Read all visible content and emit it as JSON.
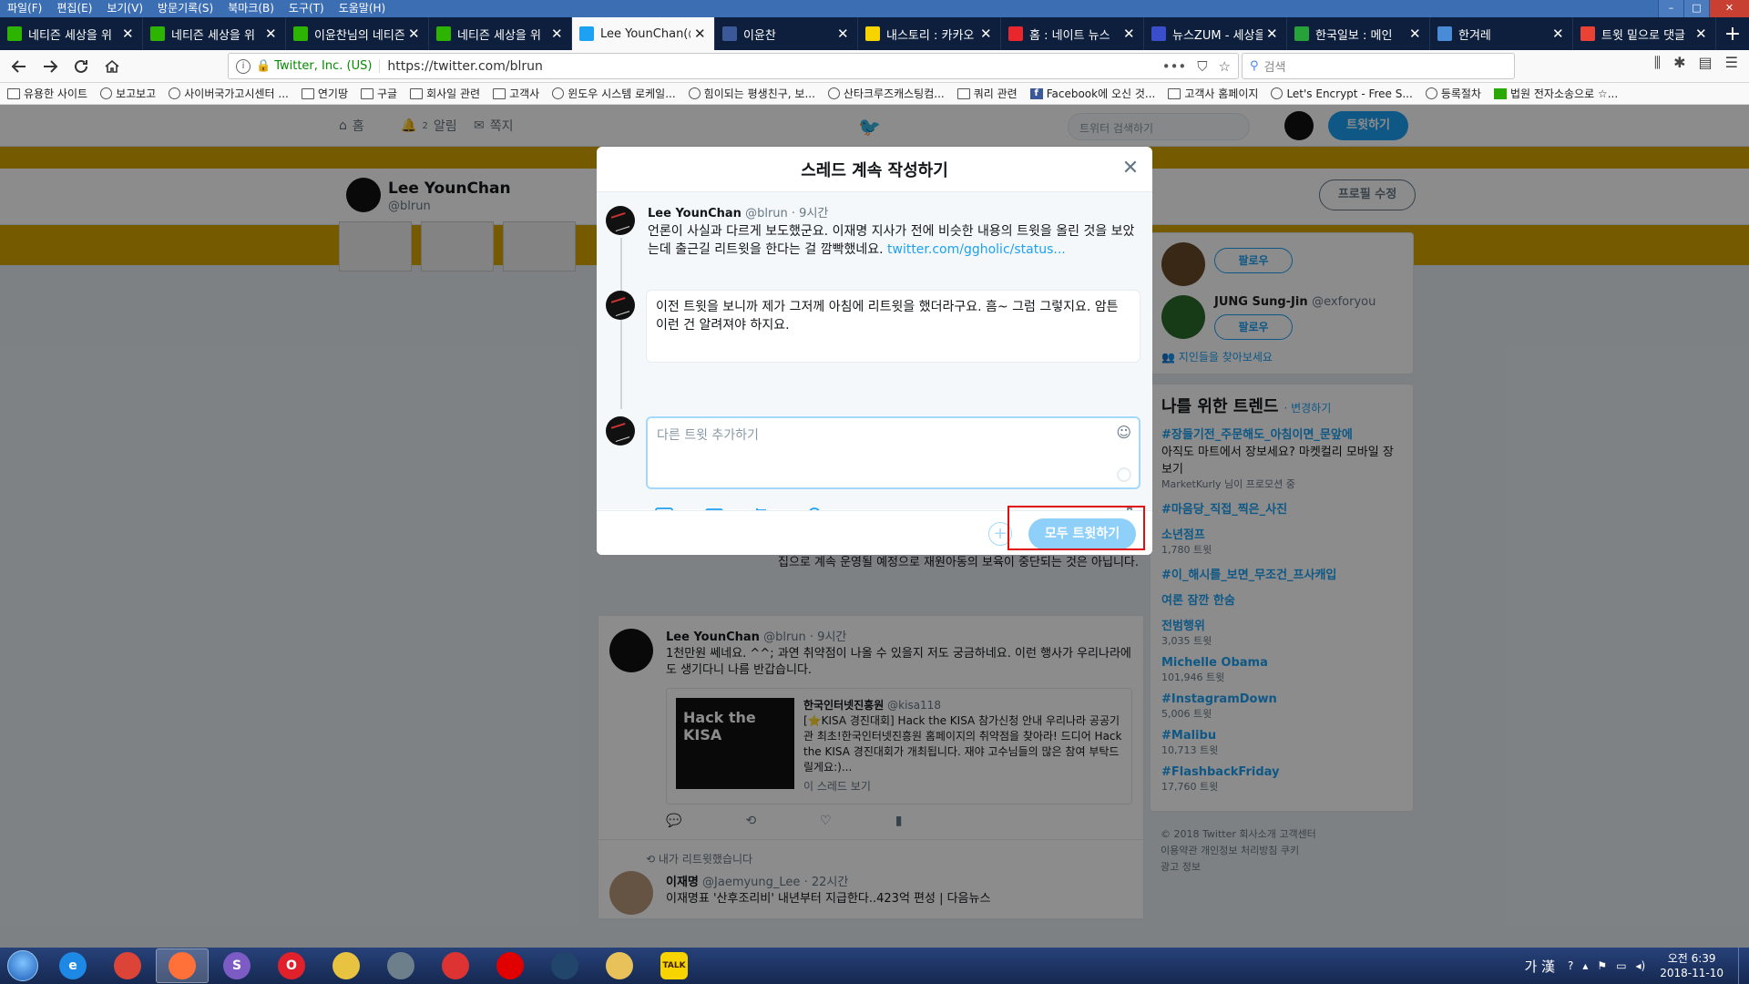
{
  "browser": {
    "menu": [
      "파일(F)",
      "편집(E)",
      "보기(V)",
      "방문기록(S)",
      "북마크(B)",
      "도구(T)",
      "도움말(H)"
    ],
    "tabs": [
      {
        "title": "네티즌 세상을 위",
        "icon": "naver-icon",
        "color": "#2db400"
      },
      {
        "title": "네티즌 세상을 위",
        "icon": "naver-icon",
        "color": "#2db400"
      },
      {
        "title": "이윤찬님의 네티즌",
        "icon": "naver-icon",
        "color": "#2db400"
      },
      {
        "title": "네티즌 세상을 위",
        "icon": "naver-icon",
        "color": "#2db400"
      },
      {
        "title": "Lee YounChan(@",
        "icon": "twitter-icon",
        "color": "#1da1f2",
        "active": true
      },
      {
        "title": "이윤찬",
        "icon": "facebook-icon",
        "color": "#3b5998"
      },
      {
        "title": "내스토리 : 카카오",
        "icon": "kakao-icon",
        "color": "#f7d300"
      },
      {
        "title": "홈 : 네이트 뉴스",
        "icon": "nate-icon",
        "color": "#e8262c"
      },
      {
        "title": "뉴스ZUM - 세상을",
        "icon": "zum-icon",
        "color": "#3a4ecb"
      },
      {
        "title": "한국일보 : 메인",
        "icon": "hankook-icon",
        "color": "#27a13a"
      },
      {
        "title": "한겨레",
        "icon": "hani-icon",
        "color": "#4a8bd8"
      },
      {
        "title": "트윗 밑으로 댓글",
        "icon": "google-icon",
        "color": "#ea4335"
      }
    ],
    "identity": "Twitter, Inc. (US)",
    "url": "https://twitter.com/blrun",
    "search_placeholder": "검색",
    "bookmarks": [
      {
        "label": "유용한 사이트",
        "icon": "folder"
      },
      {
        "label": "보고보고",
        "icon": "globe"
      },
      {
        "label": "사이버국가고시센터 ...",
        "icon": "globe"
      },
      {
        "label": "연기땅",
        "icon": "folder"
      },
      {
        "label": "구글",
        "icon": "folder"
      },
      {
        "label": "회사일 관련",
        "icon": "folder"
      },
      {
        "label": "고객사",
        "icon": "folder"
      },
      {
        "label": "윈도우 시스템 로케일...",
        "icon": "globe"
      },
      {
        "label": "힘이되는 평생친구, 보...",
        "icon": "globe"
      },
      {
        "label": "산타크루즈캐스팅컴...",
        "icon": "globe"
      },
      {
        "label": "쿼리 관련",
        "icon": "folder"
      },
      {
        "label": "Facebook에 오신 것...",
        "icon": "fb"
      },
      {
        "label": "고객사 홈페이지",
        "icon": "folder"
      },
      {
        "label": "Let's Encrypt - Free S...",
        "icon": "globe"
      },
      {
        "label": "등록절차",
        "icon": "globe"
      },
      {
        "label": "법원 전자소송으로 ☆...",
        "icon": "green"
      }
    ]
  },
  "twitter": {
    "nav": {
      "home": "홈",
      "notifications": "알림",
      "notif_count": "2",
      "messages": "쪽지"
    },
    "search_placeholder": "트위터 검색하기",
    "tweet_button": "트윗하기",
    "profile": {
      "name": "Lee YounChan",
      "handle": "@blrun",
      "edit_button": "프로필 수정"
    },
    "who_to_follow": [
      {
        "name": "",
        "handle": "",
        "button": "팔로우"
      },
      {
        "name": "JUNG Sung-Jin",
        "handle": "@exforyou",
        "button": "팔로우"
      }
    ],
    "find_friends": "지인들을 찾아보세요",
    "trends_title": "나를 위한 트렌드",
    "trends_change": "· 변경하기",
    "trends": [
      {
        "name": "#장들기전_주문해도_아침이면_문앞에",
        "desc": "아직도 마트에서 장보세요? 마켓컬리 모바일 장보기",
        "count": "MarketKurly 님이 프로모션 중"
      },
      {
        "name": "#마음당_직접_찍은_사진",
        "desc": "",
        "count": ""
      },
      {
        "name": "소년점프",
        "desc": "",
        "count": "1,780 트윗"
      },
      {
        "name": "#이_해시를_보면_무조건_프사캐입",
        "desc": "",
        "count": ""
      },
      {
        "name": "여론 잠깐 한숨",
        "desc": "",
        "count": ""
      },
      {
        "name": "전범행위",
        "desc": "",
        "count": "3,035 트윗"
      },
      {
        "name": "Michelle Obama",
        "desc": "",
        "count": "101,946 트윗"
      },
      {
        "name": "#InstagramDown",
        "desc": "",
        "count": "5,006 트윗"
      },
      {
        "name": "#Malibu",
        "desc": "",
        "count": "10,713 트윗"
      },
      {
        "name": "#FlashbackFriday",
        "desc": "",
        "count": "17,760 트윗"
      }
    ],
    "footer": [
      "© 2018 Twitter  회사소개  고객센터",
      "이용약관  개인정보 처리방침  쿠키",
      "광고 정보"
    ],
    "timeline_snippet": "집으로 계속 운영될 예정으로 재원아동의 보육이 중단되는 것은 아닙니다.",
    "timeline": [
      {
        "name": "Lee YounChan",
        "handle": "@blrun",
        "time": "· 9시간",
        "text": "1천만원 쎄네요. ^^; 과연 취약점이 나올 수 있을지 저도 궁금하네요. 이런 행사가 우리나라에도 생기다니 나름 반갑습니다.",
        "quote_name": "한국인터넷진흥원",
        "quote_handle": "@kisa118",
        "quote_text": "[⭐KISA 경진대회] Hack the KISA 참가신청 안내 우리나라 공공기관 최초!한국인터넷진흥원 홈페이지의 취약점을 찾아라! 드디어 Hack the KISA 경진대회가 개최됩니다. 재야 고수님들의 많은 참여 부탁드릴게요:)...",
        "quote_image_text": "Hack the KISA",
        "thread_link": "이 스레드 보기"
      }
    ],
    "retweet_note": "내가 리트윗했습니다",
    "retweeted": {
      "name": "이재명",
      "handle": "@Jaemyung_Lee",
      "time": "· 22시간",
      "text": "이재명표 '산후조리비' 내년부터 지급한다..423억 편성 | 다음뉴스"
    }
  },
  "modal": {
    "title": "스레드 계속 작성하기",
    "original": {
      "name": "Lee YounChan",
      "handle": "@blrun",
      "time": "· 9시간",
      "text": "언론이 사실과 다르게 보도했군요. 이재명 지사가 전에 비슷한 내용의 트윗을 올린 것을 보았는데 출근길 리트윗을 한다는 걸 깜빡했네요.",
      "link": "twitter.com/ggholic/status..."
    },
    "draft_text": "이전 트윗을 보니까 제가 그저께 아침에 리트윗을 했더라구요. 흠~ 그럼 그렇지요. 암튼 이런 건 알려져야 하지요.",
    "compose_placeholder": "다른 트윗 추가하기",
    "add_label": "+",
    "tweet_all_label": "모두 트윗하기",
    "tweet_all_color": "#8ed0f9"
  },
  "taskbar": {
    "apps": [
      {
        "name": "ie-icon",
        "label": "e",
        "color": "#1e88e5"
      },
      {
        "name": "chrome-icon",
        "label": "",
        "color": "#db4437"
      },
      {
        "name": "firefox-icon",
        "label": "",
        "color": "#ff7139",
        "active": true
      },
      {
        "name": "sapp-icon",
        "label": "S",
        "color": "#7c5cc4"
      },
      {
        "name": "opera-icon",
        "label": "O",
        "color": "#e0202a"
      },
      {
        "name": "sticky-icon",
        "label": "",
        "color": "#e8c341"
      },
      {
        "name": "book-icon",
        "label": "",
        "color": "#6e7f8c"
      },
      {
        "name": "pokeball-icon",
        "label": "",
        "color": "#d33"
      },
      {
        "name": "record-icon",
        "label": "",
        "color": "#e00000"
      },
      {
        "name": "network-icon",
        "label": "",
        "color": "#22456b"
      },
      {
        "name": "folder-icon",
        "label": "",
        "color": "#e9c15a"
      },
      {
        "name": "kakaotalk-icon",
        "label": "TALK",
        "color": "#f7d300"
      }
    ],
    "ime": "가 漢",
    "clock_time": "오전 6:39",
    "clock_date": "2018-11-10"
  }
}
